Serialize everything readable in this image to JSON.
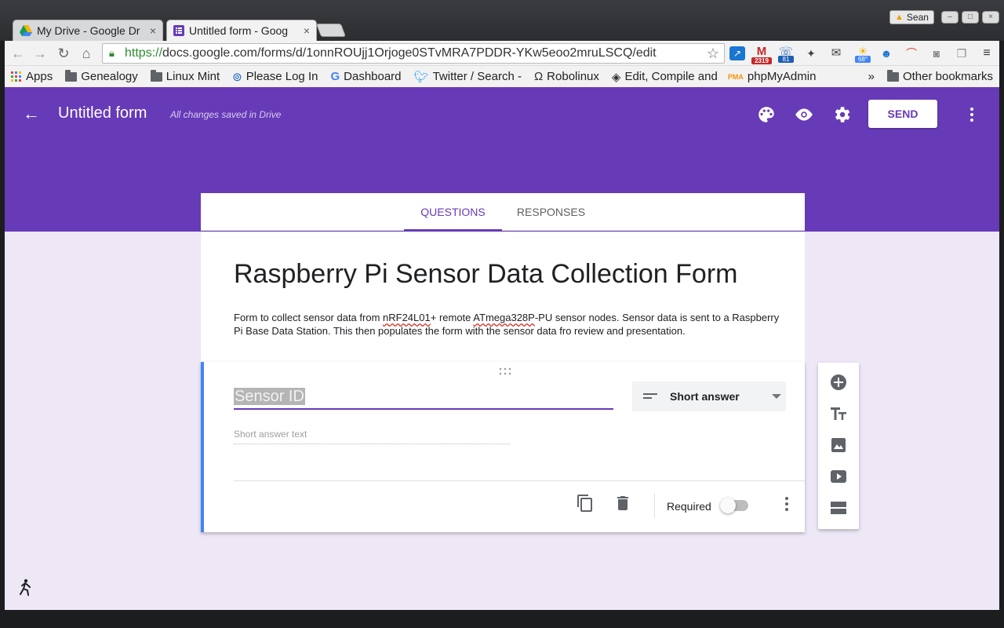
{
  "browser": {
    "tabs": [
      {
        "title": "My Drive - Google Dr"
      },
      {
        "title": "Untitled form - Goog"
      }
    ],
    "tab_close": "×",
    "user_name": "Sean",
    "url_scheme": "https://",
    "url_rest": "docs.google.com/forms/d/1onnROUjj1Orjoge0STvMRA7PDDR-YKw5eoo2mruLSCQ/edit",
    "extension_badges": {
      "gmail_count": "2319",
      "phone_count": "81",
      "weather_temp": "68°"
    },
    "bookmarks": [
      {
        "label": "Apps",
        "icon": "apps-grid-icon"
      },
      {
        "label": "Genealogy",
        "icon": "folder-icon"
      },
      {
        "label": "Linux Mint",
        "icon": "folder-icon"
      },
      {
        "label": "Please Log In",
        "icon": "site-icon"
      },
      {
        "label": "Dashboard",
        "icon": "google-icon"
      },
      {
        "label": "Twitter / Search -",
        "icon": "twitter-icon"
      },
      {
        "label": "Robolinux",
        "icon": "site-icon"
      },
      {
        "label": "Edit, Compile and",
        "icon": "site-icon"
      },
      {
        "label": "phpMyAdmin",
        "icon": "pma-icon"
      }
    ],
    "bookmarks_overflow": "»",
    "other_bookmarks": "Other bookmarks"
  },
  "header": {
    "form_title": "Untitled form",
    "save_status": "All changes saved in Drive",
    "send_label": "SEND"
  },
  "tabs": {
    "questions": "QUESTIONS",
    "responses": "RESPONSES"
  },
  "form": {
    "title": "Raspberry Pi Sensor Data Collection Form",
    "description_parts": [
      "Form to collect sensor data from ",
      "nRF24L01",
      "+ remote ",
      "ATmega328P",
      "-PU sensor nodes. Sensor data is sent to a Raspberry Pi Base Data Station. This then populates the form with the sensor data fro review and presentation."
    ]
  },
  "question": {
    "title": "Sensor ID",
    "type": "Short answer",
    "answer_placeholder": "Short answer text",
    "required_label": "Required",
    "required": false
  },
  "colors": {
    "brand": "#673ab7",
    "page_bg": "#ede7f6",
    "question_accent": "#4285f4"
  }
}
